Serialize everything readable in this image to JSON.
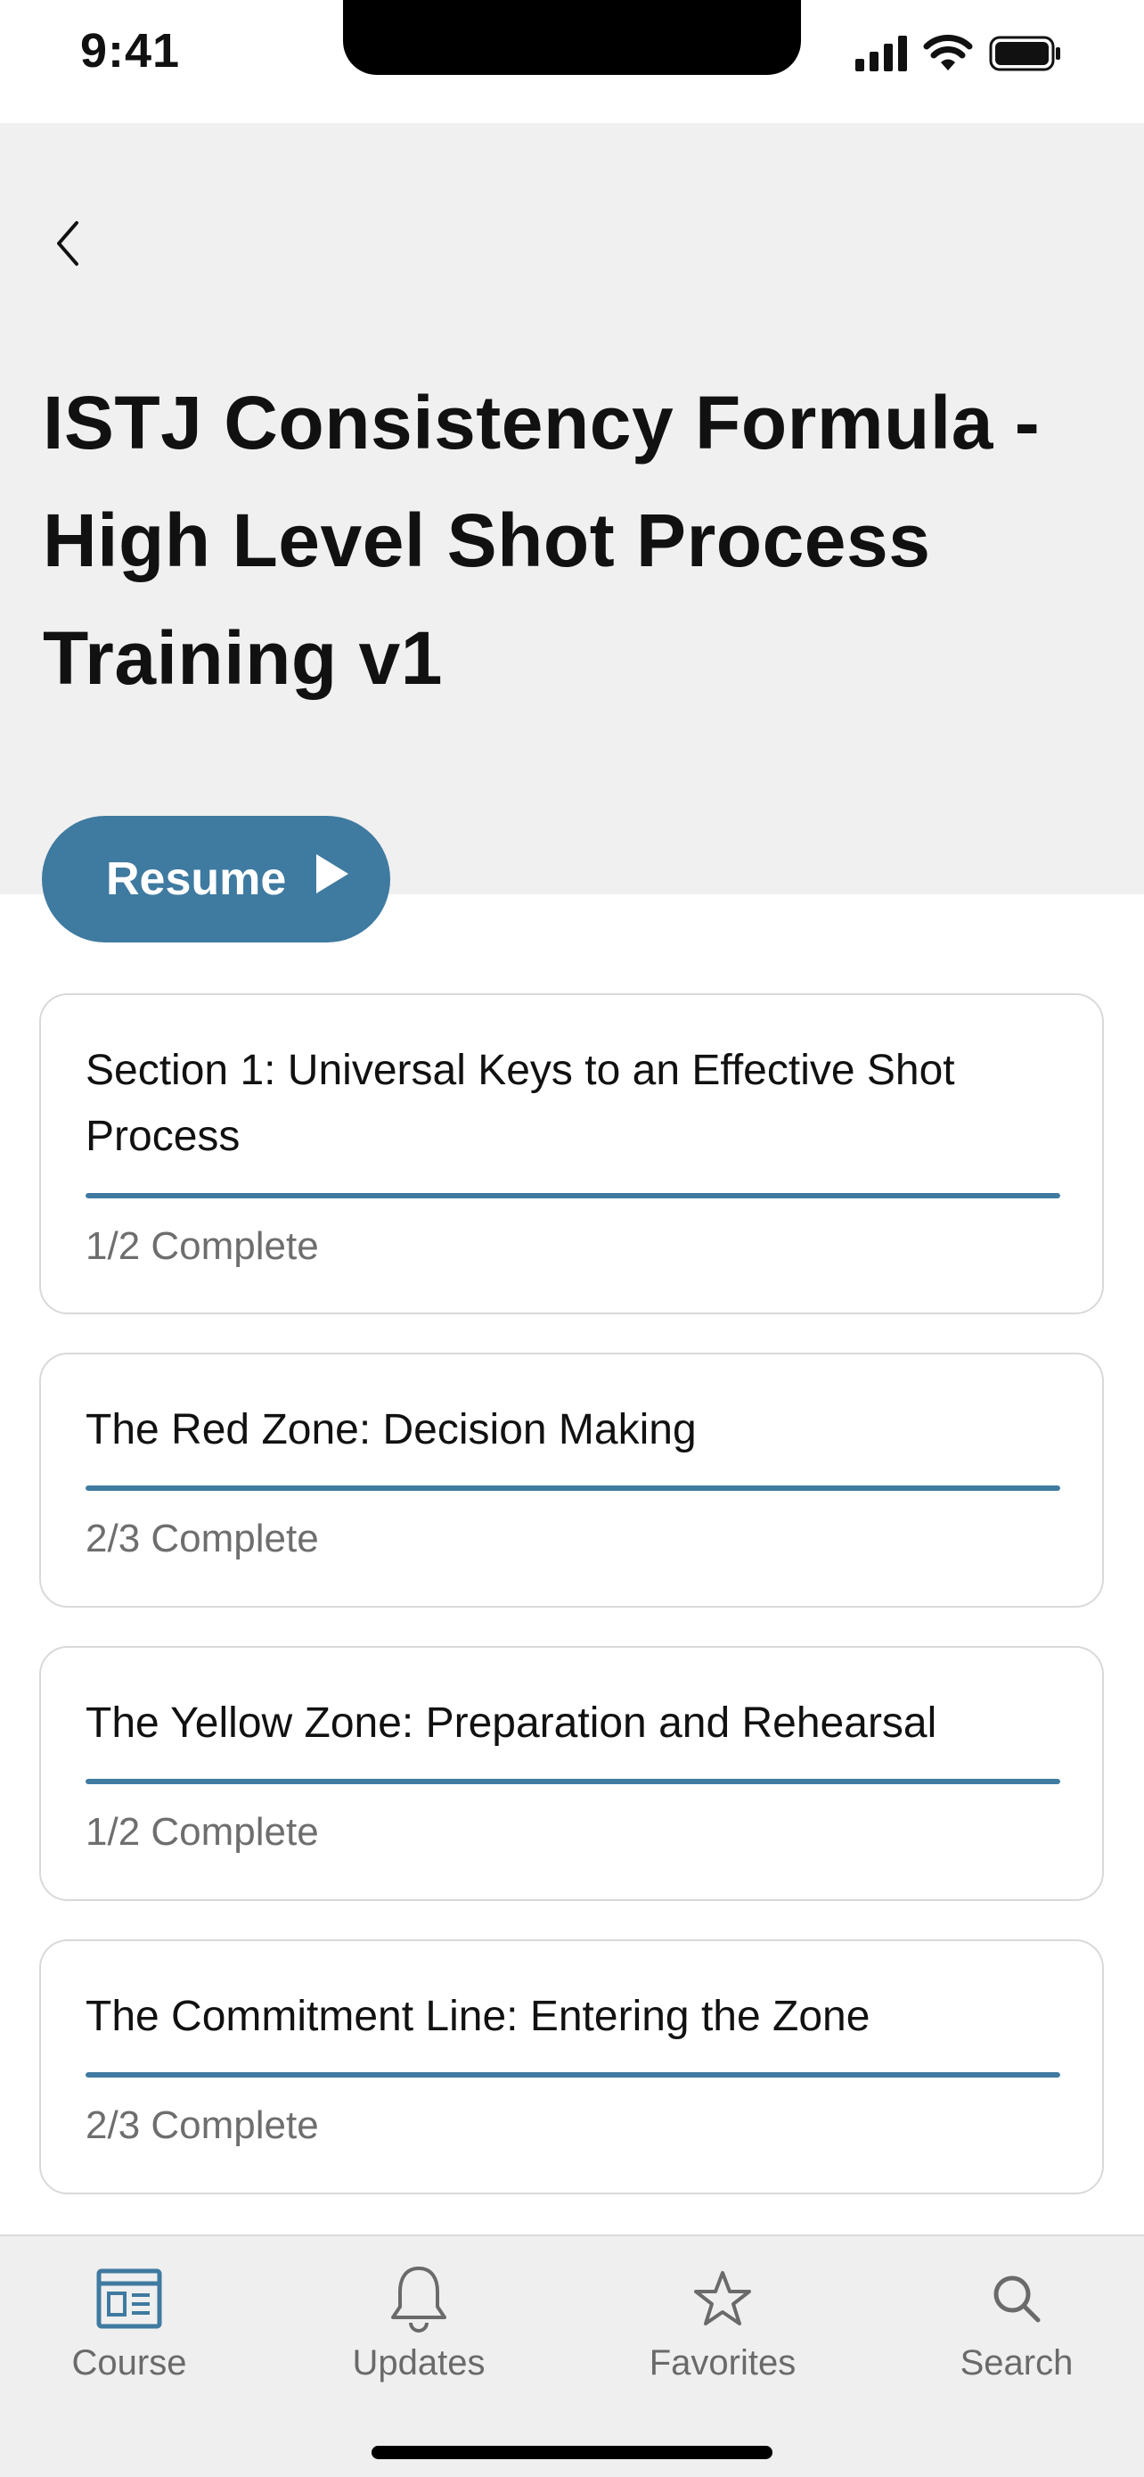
{
  "status_bar": {
    "time": "9:41"
  },
  "header": {
    "title": "ISTJ Consistency Formula - High Level Shot Process Training v1",
    "resume_label": "Resume"
  },
  "sections": [
    {
      "title": "Section 1: Universal Keys to an Effective Shot Process",
      "status": "1/2 Complete",
      "progress": 1.0
    },
    {
      "title": "The Red Zone: Decision Making",
      "status": "2/3 Complete",
      "progress": 1.0
    },
    {
      "title": "The Yellow Zone: Preparation and Rehearsal",
      "status": "1/2 Complete",
      "progress": 1.0
    },
    {
      "title": "The Commitment Line: Entering the Zone",
      "status": "2/3 Complete",
      "progress": 1.0
    }
  ],
  "tab_bar": {
    "tabs": [
      {
        "label": "Course",
        "icon": "course-icon",
        "active": true
      },
      {
        "label": "Updates",
        "icon": "bell-icon",
        "active": false
      },
      {
        "label": "Favorites",
        "icon": "star-icon",
        "active": false
      },
      {
        "label": "Search",
        "icon": "search-icon",
        "active": false
      }
    ]
  },
  "colors": {
    "accent": "#3f7aa0",
    "header_bg": "#f0f0f0",
    "muted_text": "#6e6e6e"
  }
}
